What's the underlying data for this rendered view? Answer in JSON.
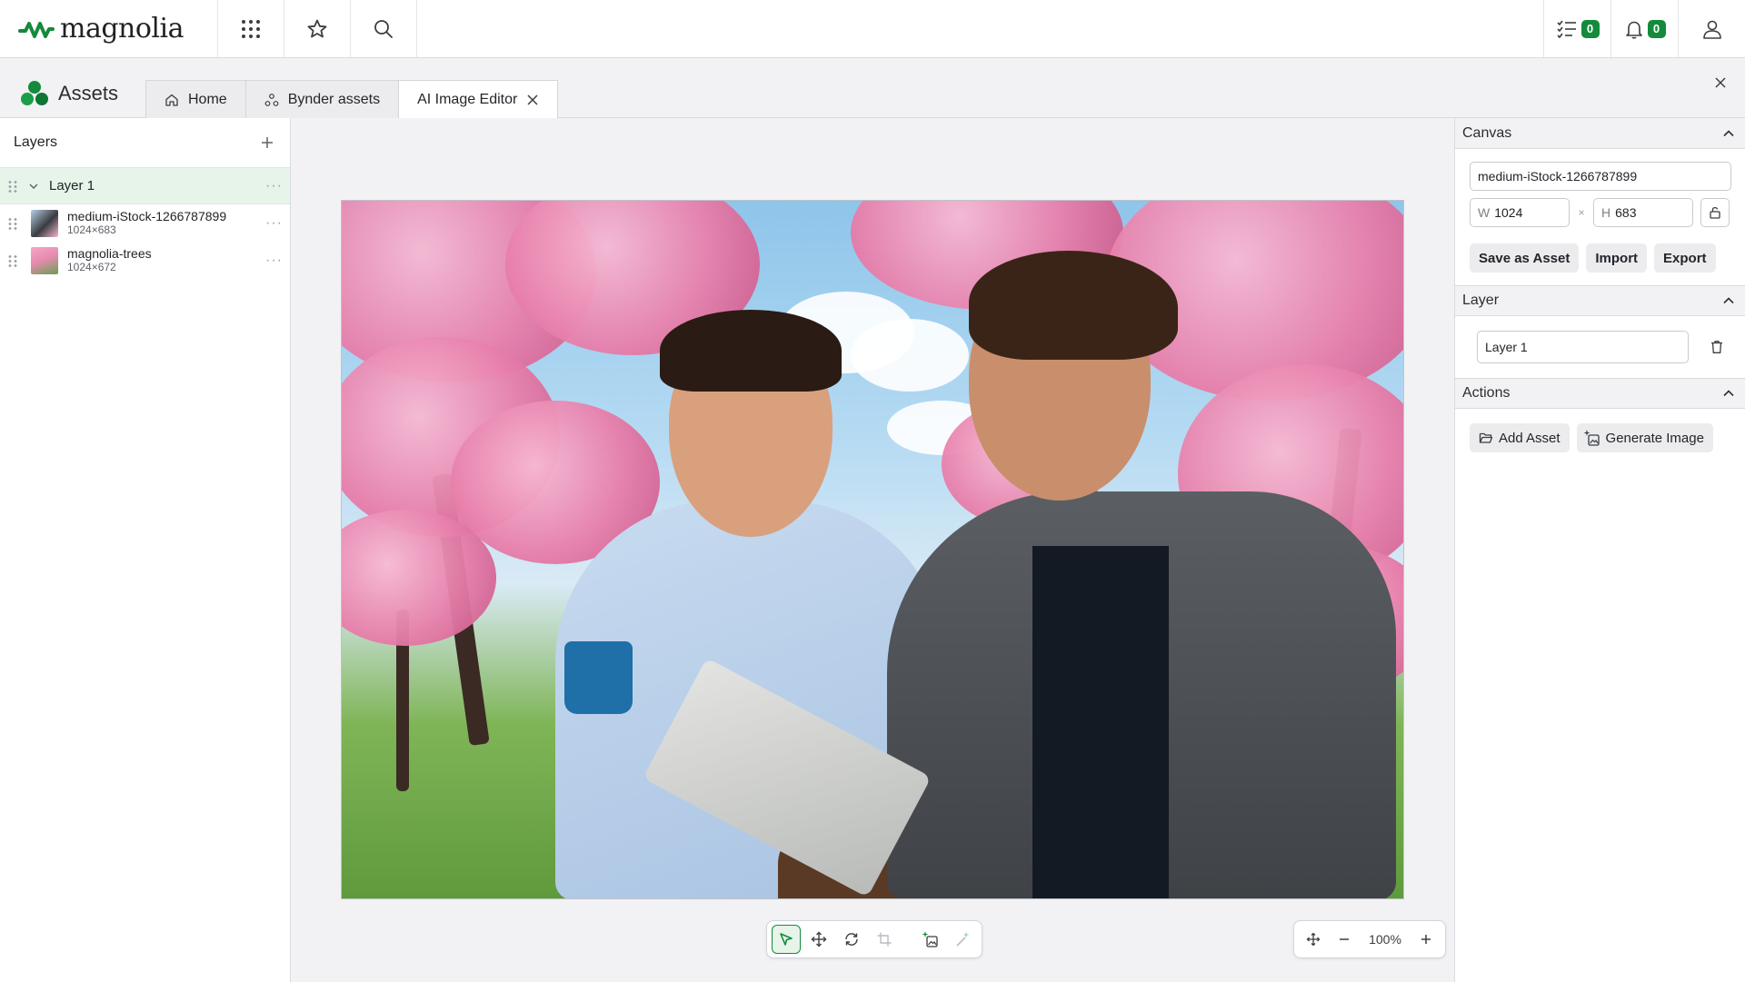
{
  "topbar": {
    "brand": "magnolia",
    "tasks_count": "0",
    "notifications_count": "0"
  },
  "app": {
    "title": "Assets",
    "tabs": [
      {
        "label": "Home"
      },
      {
        "label": "Bynder assets"
      },
      {
        "label": "AI Image Editor"
      }
    ]
  },
  "layers": {
    "title": "Layers",
    "group": {
      "name": "Layer 1"
    },
    "items": [
      {
        "name": "medium-iStock-1266787899",
        "size": "1024×683"
      },
      {
        "name": "magnolia-trees",
        "size": "1024×672"
      }
    ]
  },
  "canvas_tools": {
    "zoom": "100%"
  },
  "panel": {
    "canvas": {
      "title": "Canvas",
      "name_value": "medium-iStock-1266787899",
      "w_prefix": "W",
      "w_value": "1024",
      "h_prefix": "H",
      "h_value": "683",
      "times": "×",
      "buttons": [
        "Save as Asset",
        "Import",
        "Export"
      ]
    },
    "layer": {
      "title": "Layer",
      "name_value": "Layer 1"
    },
    "actions": {
      "title": "Actions",
      "add_asset": "Add Asset",
      "generate_image": "Generate Image"
    }
  },
  "colors": {
    "accent": "#148a3c",
    "selected_bg": "#e7f4ea"
  }
}
